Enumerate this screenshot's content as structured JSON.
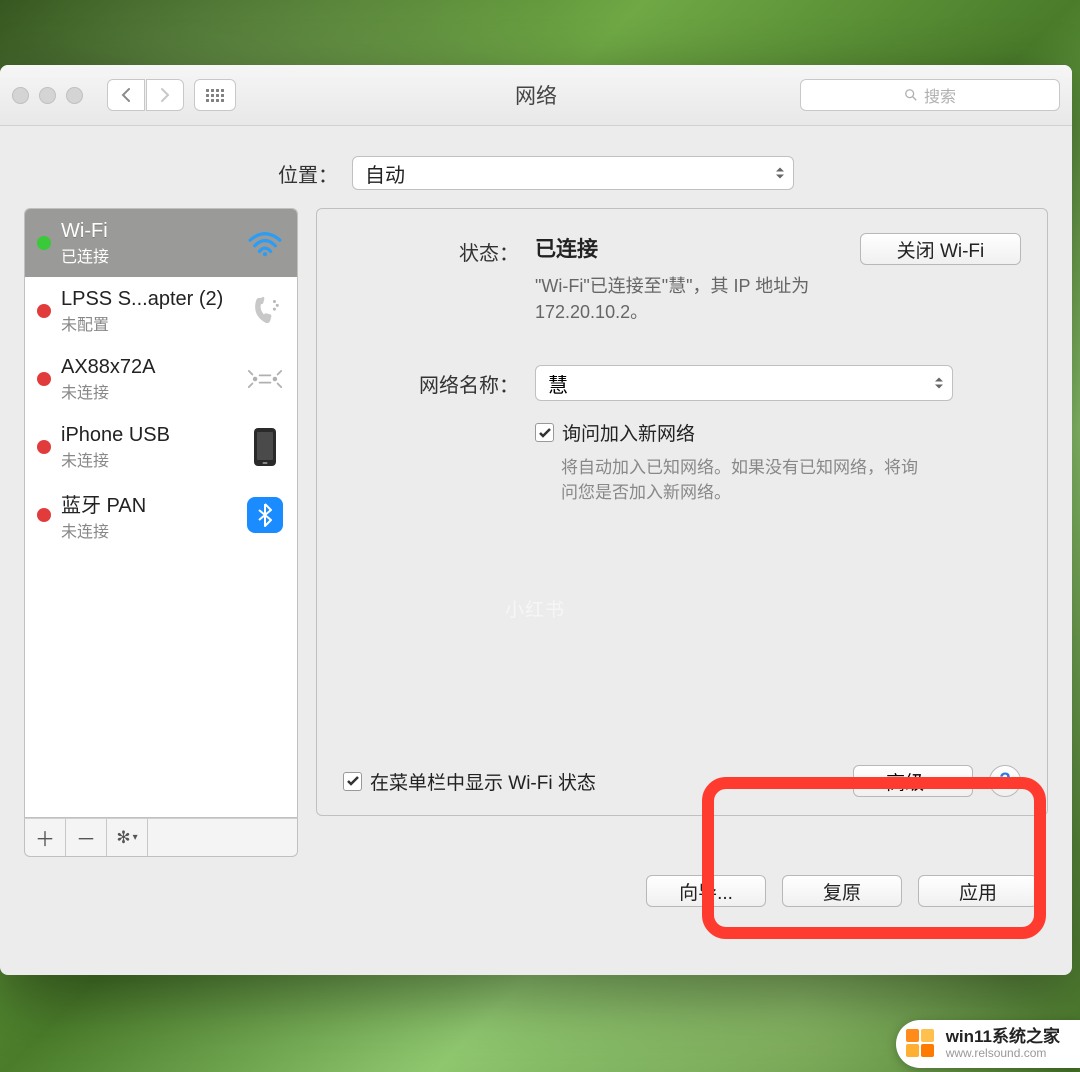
{
  "window": {
    "title": "网络",
    "search_placeholder": "搜索"
  },
  "location": {
    "label": "位置：",
    "value": "自动"
  },
  "interfaces": [
    {
      "name": "Wi-Fi",
      "status": "已连接",
      "dot": "green",
      "icon": "wifi",
      "selected": true
    },
    {
      "name": "LPSS S...apter (2)",
      "status": "未配置",
      "dot": "red",
      "icon": "phone",
      "selected": false
    },
    {
      "name": "AX88x72A",
      "status": "未连接",
      "dot": "red",
      "icon": "eth",
      "selected": false
    },
    {
      "name": "iPhone USB",
      "status": "未连接",
      "dot": "red",
      "icon": "iphone",
      "selected": false
    },
    {
      "name": "蓝牙 PAN",
      "status": "未连接",
      "dot": "red",
      "icon": "bt",
      "selected": false
    }
  ],
  "main": {
    "status_label": "状态：",
    "status_value": "已连接",
    "turnoff_label": "关闭 Wi-Fi",
    "status_desc": "\"Wi-Fi\"已连接至\"慧\"，其 IP 地址为172.20.10.2。",
    "network_name_label": "网络名称：",
    "network_name_value": "慧",
    "ask_join_label": "询问加入新网络",
    "ask_join_desc": "将自动加入已知网络。如果没有已知网络，将询问您是否加入新网络。",
    "show_menu_label": "在菜单栏中显示 Wi-Fi 状态",
    "advanced_label": "高级...",
    "help_label": "?"
  },
  "footer": {
    "wizard": "向导...",
    "revert": "复原",
    "apply": "应用"
  },
  "watermark": {
    "center": "小红书",
    "brand_line1": "win11系统之家",
    "brand_line2": "www.relsound.com"
  },
  "colors": {
    "highlight": "#ff3b2f",
    "dot_green": "#39c939",
    "dot_red": "#e23b3b",
    "bt_blue": "#1a8cff"
  }
}
